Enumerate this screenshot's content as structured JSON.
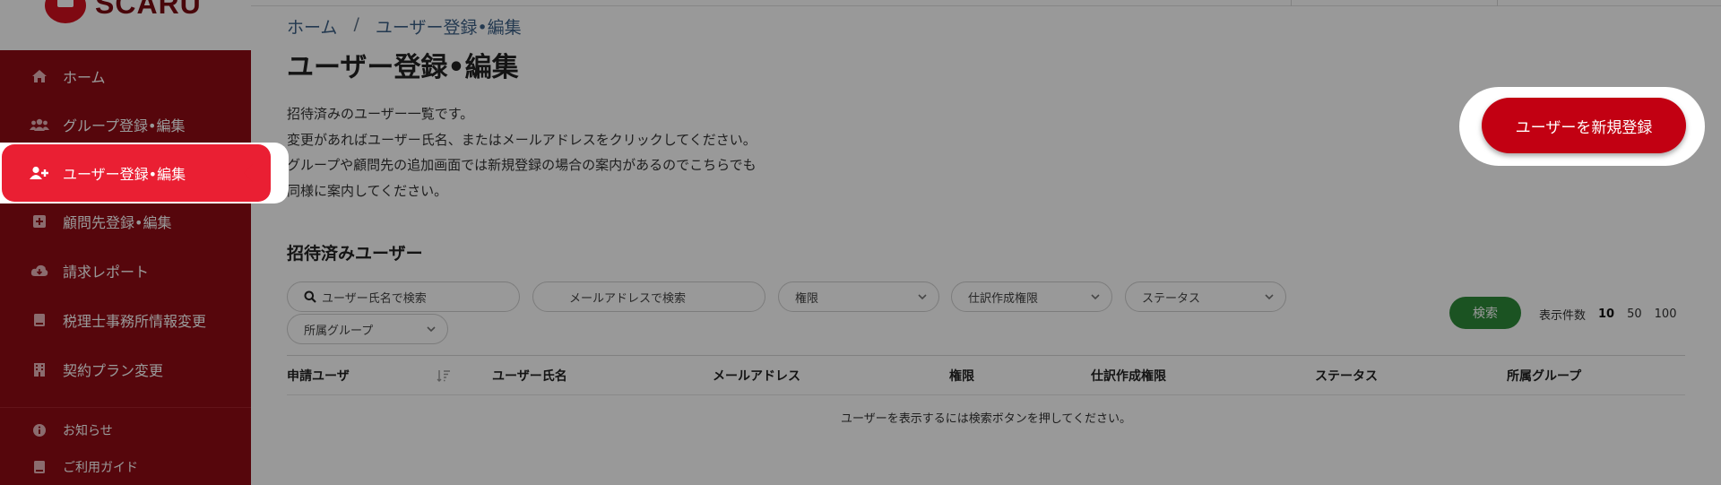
{
  "brand": {
    "logo_text": "SCARU"
  },
  "sidebar": {
    "items": [
      {
        "label": "ホーム",
        "icon": "home-icon"
      },
      {
        "label": "グループ登録•編集",
        "icon": "users-icon"
      },
      {
        "label": "ユーザー登録•編集",
        "icon": "user-plus-icon",
        "active": true
      },
      {
        "label": "顧問先登録•編集",
        "icon": "plus-square-icon"
      },
      {
        "label": "請求レポート",
        "icon": "cloud-download-icon"
      },
      {
        "label": "税理士事務所情報変更",
        "icon": "book-icon"
      },
      {
        "label": "契約プラン変更",
        "icon": "building-icon"
      }
    ],
    "bottom_items": [
      {
        "label": "お知らせ",
        "icon": "info-icon"
      },
      {
        "label": "ご利用ガイド",
        "icon": "guide-icon"
      }
    ]
  },
  "breadcrumb": {
    "home": "ホーム",
    "separator": "/",
    "current": "ユーザー登録•編集"
  },
  "page": {
    "title": "ユーザー登録•編集",
    "description": [
      "招待済みのユーザー一覧です。",
      "変更があればユーザー氏名、またはメールアドレスをクリックしてください。",
      "グループや顧問先の追加画面では新規登録の場合の案内があるのでこちらでも",
      "同様に案内してください。"
    ],
    "new_user_button": "ユーザーを新規登録"
  },
  "section": {
    "title": "招待済みユーザー"
  },
  "filters": {
    "name_search_placeholder": "ユーザー氏名で検索",
    "email_search_placeholder": "メールアドレスで検索",
    "role": "権限",
    "journal_permission": "仕訳作成権限",
    "status": "ステータス",
    "group": "所属グループ",
    "search_button": "検索"
  },
  "pagination": {
    "label": "表示件数",
    "options": [
      "10",
      "50",
      "100"
    ],
    "selected": "10"
  },
  "table": {
    "columns": [
      "申請ユーザ",
      "ユーザー氏名",
      "メールアドレス",
      "権限",
      "仕訳作成権限",
      "ステータス",
      "所属グループ"
    ],
    "empty_message": "ユーザーを表示するには検索ボタンを押してください。"
  },
  "colors": {
    "sidebar_bg": "#8f0a14",
    "sidebar_active": "#ea1f33",
    "primary": "#c20012",
    "search_button": "#2e8a3a",
    "breadcrumb": "#3b5f86"
  }
}
